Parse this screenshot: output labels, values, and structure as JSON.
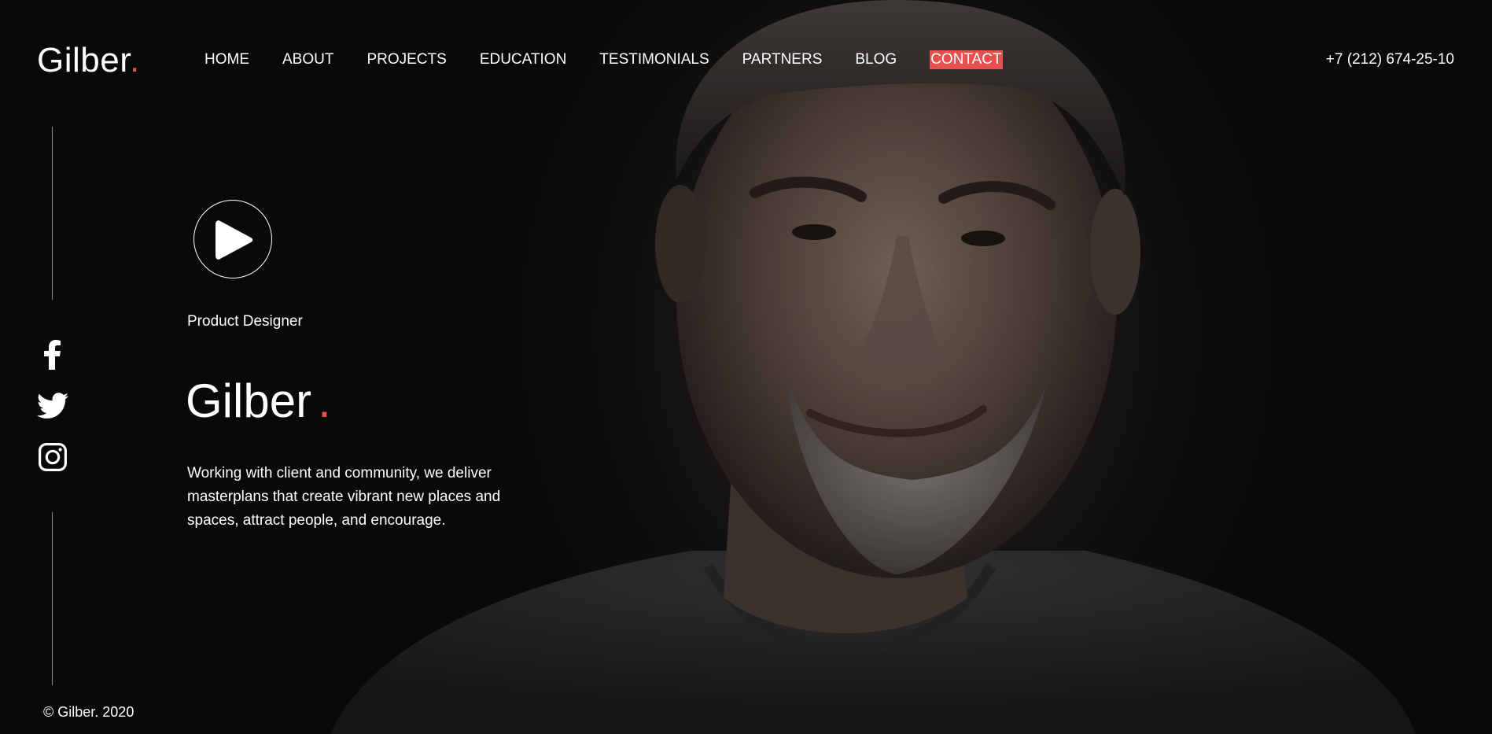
{
  "brand": {
    "name": "Gilber",
    "dot": "."
  },
  "nav": {
    "items": [
      {
        "label": "HOME"
      },
      {
        "label": "ABOUT"
      },
      {
        "label": "PROJECTS"
      },
      {
        "label": "EDUCATION"
      },
      {
        "label": "TESTIMONIALS"
      },
      {
        "label": "PARTNERS"
      },
      {
        "label": "BLOG"
      },
      {
        "label": "CONTACT"
      }
    ],
    "active": "CONTACT"
  },
  "phone": "+7 (212) 674-25-10",
  "social": [
    "facebook-icon",
    "twitter-icon",
    "instagram-icon"
  ],
  "hero": {
    "role": "Product Designer",
    "name": "Gilber",
    "dot": ".",
    "description": "Working with client and community, we deliver masterplans that create vibrant new places and spaces, attract people, and encourage."
  },
  "footer": {
    "copyright": "© Gilber. 2020"
  },
  "colors": {
    "accent": "#e84f4f",
    "background": "#0d0d0d",
    "text": "#ffffff"
  }
}
